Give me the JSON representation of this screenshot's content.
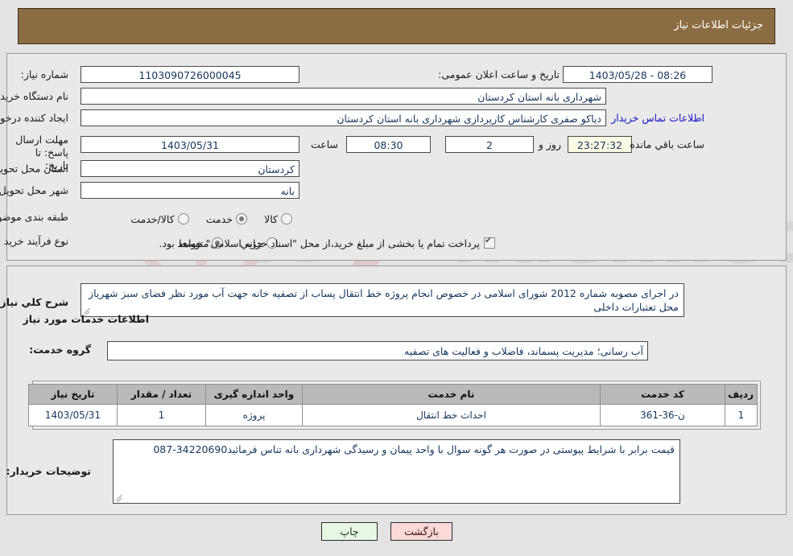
{
  "header": {
    "title": "جزئیات اطلاعات نیاز"
  },
  "top_section": {
    "need_number_label": "شماره نیاز:",
    "need_number_value": "1103090726000045",
    "announce_label": "تاریخ و ساعت اعلان عمومی:",
    "announce_value": "08:26 - 1403/05/28",
    "buyer_org_label": "نام دستگاه خریدار:",
    "buyer_org_value": "شهرداری بانه استان کردستان",
    "requester_label": "ایجاد کننده درخواست:",
    "requester_value": "دیاکو صفری کارشناس کاریردازی شهرداری بانه استان کردستان",
    "contact_link": "اطلاعات تماس خریدار",
    "deadline_label": "مهلت ارسال پاسخ: تا تاریخ:",
    "deadline_date": "1403/05/31",
    "hour_label": "ساعت",
    "deadline_time": "08:30",
    "days_value": "2",
    "days_label": "روز و",
    "timer_value": "23:27:32",
    "remaining_label": "ساعت باقي مانده",
    "province_label": "استان محل تحویل:",
    "province_value": "کردستان",
    "city_label": "شهر محل تحویل:",
    "city_value": "بانه",
    "classification_label": "طبقه بندی موضوعی:",
    "classification_options": [
      {
        "label": "کالا",
        "selected": false
      },
      {
        "label": "خدمت",
        "selected": true
      },
      {
        "label": "کالا/خدمت",
        "selected": false
      }
    ],
    "process_label": "نوع فرآیند خرید :",
    "process_options": [
      {
        "label": "جزیي",
        "selected": false
      },
      {
        "label": "متوسط",
        "selected": true
      }
    ],
    "treasury_checked": true,
    "treasury_note": "پرداخت تمام یا بخشی از مبلغ خرید،از محل \"اسناد خزانه اسلامی\" خواهد بود."
  },
  "main_section": {
    "general_desc_label": "شرح کلي نیاز:",
    "general_desc_value": "در اجرای مصوبه شماره 2012 شورای اسلامی در خصوص انجام پروژه خط انتقال پساب از تصفیه خانه جهت آب مورد نظر فضای سبز شهریاز محل تعتبارات داخلی",
    "services_heading": "اطلاعات خدمات مورد نیاز",
    "service_group_label": "گروه خدمت:",
    "service_group_value": "آب رسانی؛ مدیریت پسماند، فاضلاب و فعالیت های تصفیه",
    "table": {
      "columns": [
        "ردیف",
        "کد خدمت",
        "نام خدمت",
        "واحد اندازه گیری",
        "تعداد / مقدار",
        "تاریخ نیاز"
      ],
      "rows": [
        {
          "row_no": "1",
          "service_code": "ن-36-361",
          "service_name": "احداث خط انتقال",
          "unit": "پروژه",
          "quantity": "1",
          "need_date": "1403/05/31"
        }
      ]
    },
    "buyer_notes_label": "توضیحات خریدار:",
    "buyer_notes_value": "قیمت برابر با شرایط پیوستی در صورت هر گونه سوال با واحد پیمان و رسیدگی شهرداری بانه تناس فرمائید34220690-087"
  },
  "footer": {
    "print_button": "چاپ",
    "back_button": "بازگشت"
  },
  "colors": {
    "header_bg": "#8c6d43",
    "page_bg": "#e3e3e3",
    "panel_bg": "#e9e9e9",
    "field_text": "#15365c",
    "link": "#1414c8",
    "table_header_bg": "#b9b9b9",
    "print_button_bg": "#e8f7e4",
    "back_button_bg": "#fbd9d9",
    "timer_bg": "#fbfbe4"
  }
}
